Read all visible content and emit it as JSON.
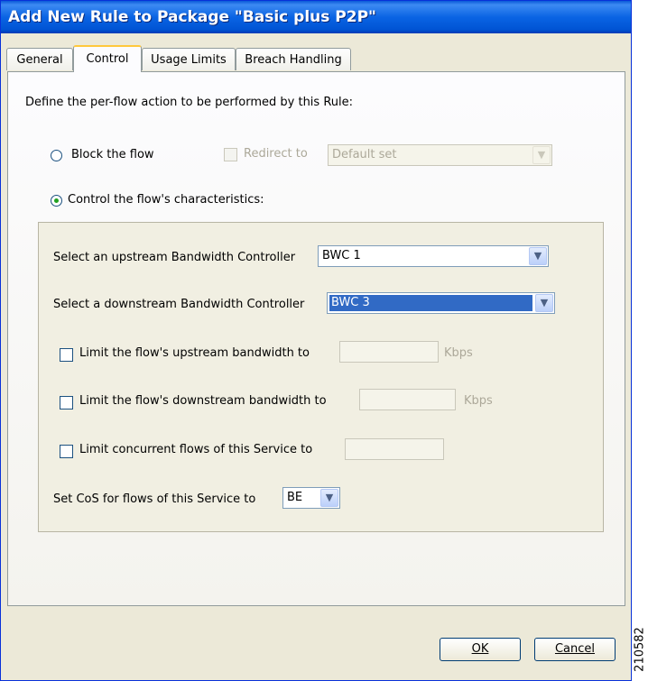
{
  "window": {
    "title": "Add New Rule to Package \"Basic plus P2P\""
  },
  "tabs": [
    {
      "label": "General",
      "active": false
    },
    {
      "label": "Control",
      "active": true
    },
    {
      "label": "Usage Limits",
      "active": false
    },
    {
      "label": "Breach Handling",
      "active": false
    }
  ],
  "control": {
    "intro": "Define the per-flow action to be performed by this Rule:",
    "block_radio": {
      "label": "Block the flow",
      "selected": false
    },
    "redirect": {
      "label": "Redirect to",
      "checked": false,
      "enabled": false,
      "value": "Default set"
    },
    "control_radio": {
      "label": "Control the flow's characteristics:",
      "selected": true
    },
    "upstream_bwc": {
      "label": "Select an upstream Bandwidth Controller",
      "value": "BWC 1"
    },
    "downstream_bwc": {
      "label": "Select a downstream Bandwidth Controller",
      "value": "BWC 3"
    },
    "limit_upstream": {
      "label": "Limit the flow's upstream bandwidth to",
      "checked": false,
      "value": "",
      "unit": "Kbps"
    },
    "limit_downstream": {
      "label": "Limit the flow's downstream bandwidth to",
      "checked": false,
      "value": "",
      "unit": "Kbps"
    },
    "limit_concurrent": {
      "label": "Limit concurrent flows of this Service to",
      "checked": false,
      "value": ""
    },
    "cos": {
      "label": "Set CoS for flows of this Service to",
      "value": "BE"
    }
  },
  "buttons": {
    "ok": "OK",
    "cancel": "Cancel"
  },
  "figure_id": "210582",
  "colors": {
    "title_bar": "#0054e3",
    "dialog_bg": "#ece9d8",
    "selection": "#316ac5",
    "radio_dot": "#21a121"
  }
}
